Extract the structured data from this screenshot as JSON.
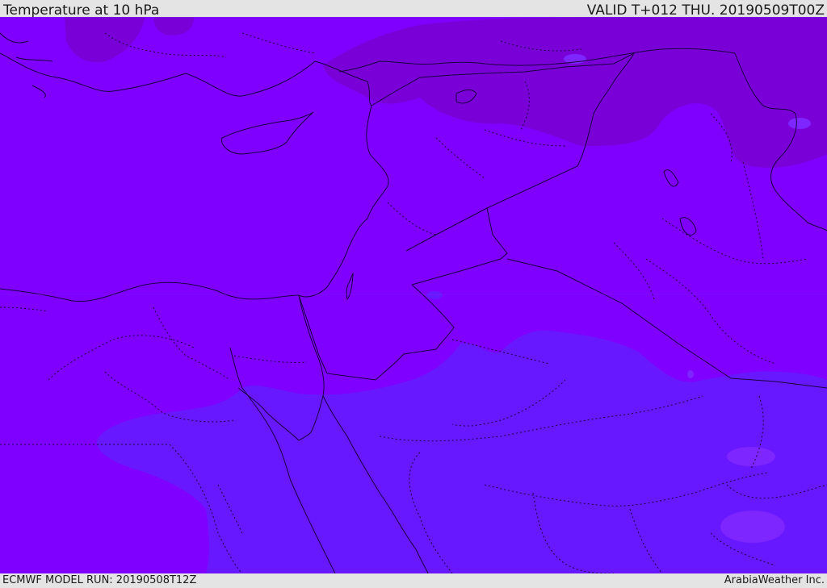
{
  "header": {
    "title": "Temperature at 10 hPa",
    "valid_time": "VALID T+012 THU. 20190509T00Z"
  },
  "footer": {
    "model_run": "ECMWF MODEL RUN: 20190508T12Z",
    "credit": "ArabiaWeather Inc."
  },
  "map": {
    "colors": {
      "base_violet": "#7f00ff",
      "dark_purple": "#7a00d8",
      "blue_violet": "#6818ff",
      "light_spots": "#7e26ff",
      "border_line": "#1a0040"
    },
    "features": [
      "cyprus",
      "sinai-peninsula",
      "red-sea",
      "dead-sea",
      "lake-van",
      "caspian-edge",
      "arabian-peninsula"
    ]
  }
}
